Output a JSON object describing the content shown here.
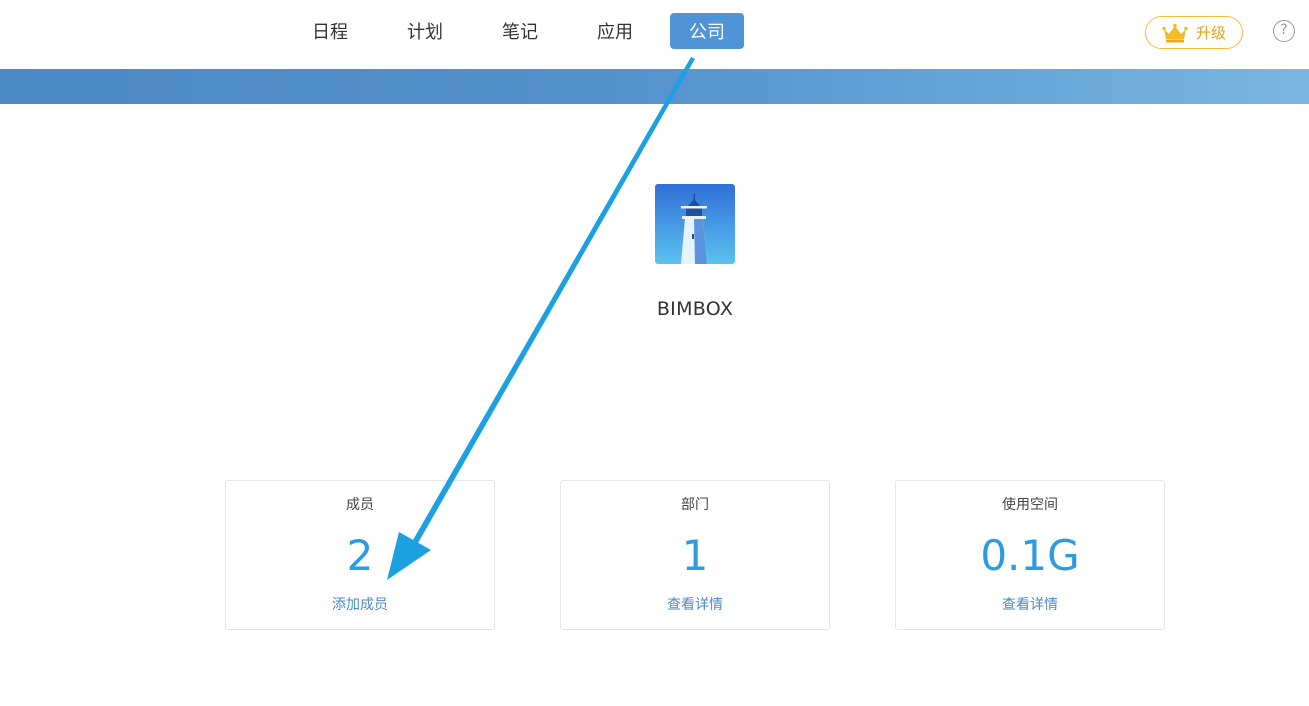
{
  "nav": {
    "tabs": [
      {
        "label": "日程"
      },
      {
        "label": "计划"
      },
      {
        "label": "笔记"
      },
      {
        "label": "应用"
      },
      {
        "label": "公司",
        "active": true
      }
    ],
    "upgrade_label": "升级",
    "upgrade_icon": "crown-icon",
    "help_icon": "help-icon",
    "help_glyph": "?"
  },
  "company": {
    "name": "BIMBOX",
    "logo_icon": "lighthouse-logo"
  },
  "stats": [
    {
      "label": "成员",
      "value": "2",
      "link": "添加成员"
    },
    {
      "label": "部门",
      "value": "1",
      "link": "查看详情"
    },
    {
      "label": "使用空间",
      "value": "0.1G",
      "link": "查看详情"
    }
  ],
  "colors": {
    "accent": "#4f94d6",
    "value_blue": "#2d9be0",
    "link_blue": "#4b8ac7",
    "upgrade_gold": "#f5bc43",
    "annotation_arrow": "#1ba1e2"
  }
}
